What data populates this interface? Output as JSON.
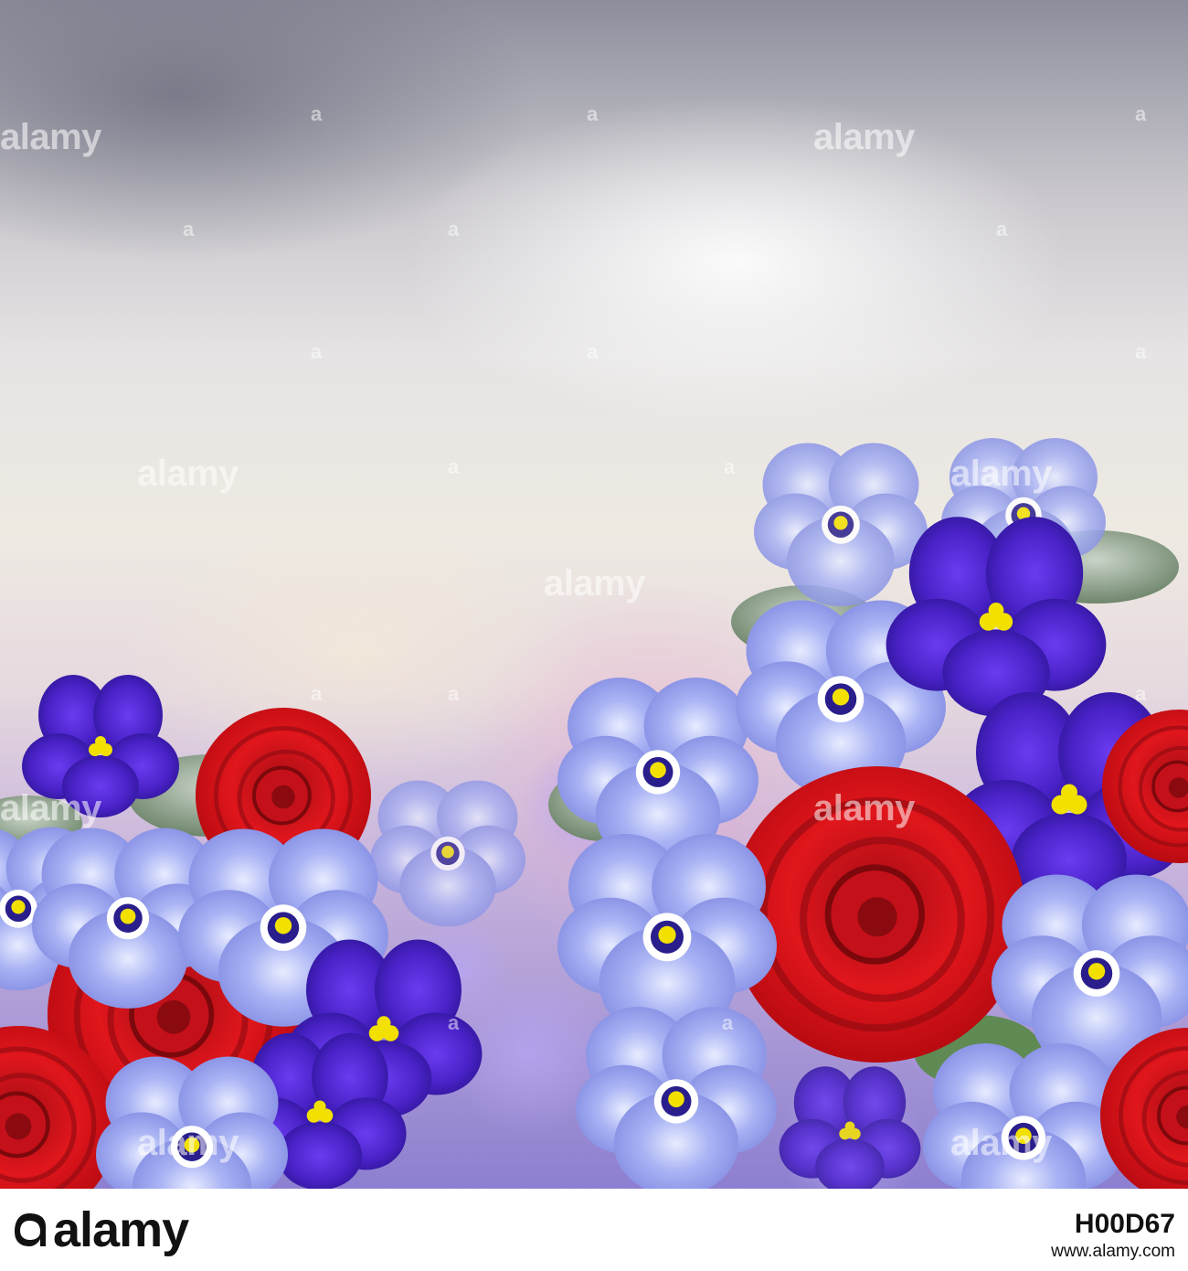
{
  "image": {
    "description_colors": {
      "sky_top": "#8c8e9c",
      "light": "#eeeae2",
      "pansy_blue": "#8f9ef0",
      "violet_dark": "#3a1fb0",
      "ranunculus_red": "#d2141a",
      "pistil_yellow": "#f2e000"
    }
  },
  "watermark": {
    "text": "alamy",
    "icon": "alamy-a-logo-icon"
  },
  "footer": {
    "brand": "alamy",
    "image_id": "H00D67",
    "url": "www.alamy.com"
  }
}
